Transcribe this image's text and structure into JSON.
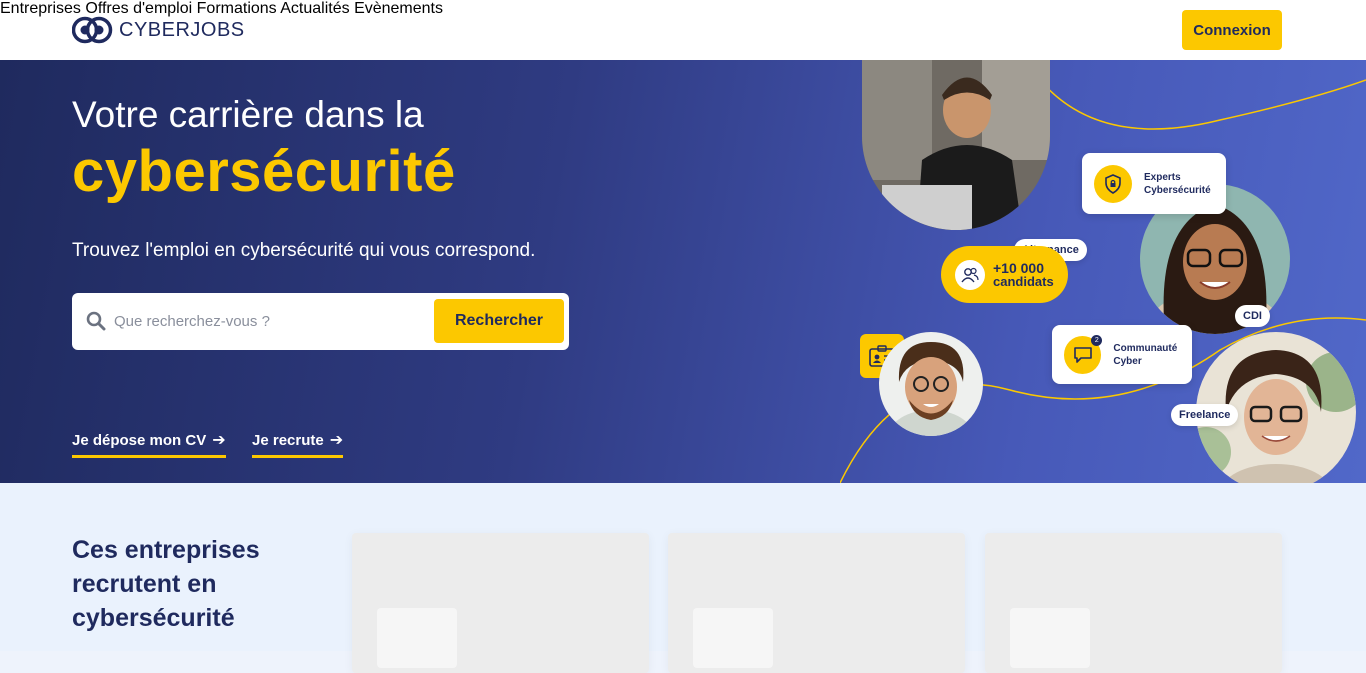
{
  "header": {
    "logo_text": "CYBERJOBS",
    "nav": [
      "Entreprises",
      "Offres d'emploi",
      "Formations",
      "Actualités",
      "Evènements"
    ],
    "login_label": "Connexion"
  },
  "hero": {
    "title_line1": "Votre carrière dans la",
    "title_line2": "cybersécurité",
    "subtitle": "Trouvez l'emploi en cybersécurité qui vous correspond.",
    "search_placeholder": "Que recherchez-vous ?",
    "search_button": "Rechercher",
    "link_cv": "Je dépose mon CV",
    "link_recruit": "Je recrute"
  },
  "illustration": {
    "tag_alternance": "Alternance",
    "tag_cdi": "CDI",
    "tag_freelance": "Freelance",
    "badge_experts": "Experts Cybersécurité",
    "badge_community": "Communauté Cyber",
    "candidates_count": "+10 000",
    "candidates_label": "candidats",
    "notification_count": "2"
  },
  "companies": {
    "title": "Ces entreprises recrutent en cybersécurité"
  },
  "colors": {
    "brand_navy": "#1f2a5e",
    "accent_yellow": "#fcc800"
  }
}
